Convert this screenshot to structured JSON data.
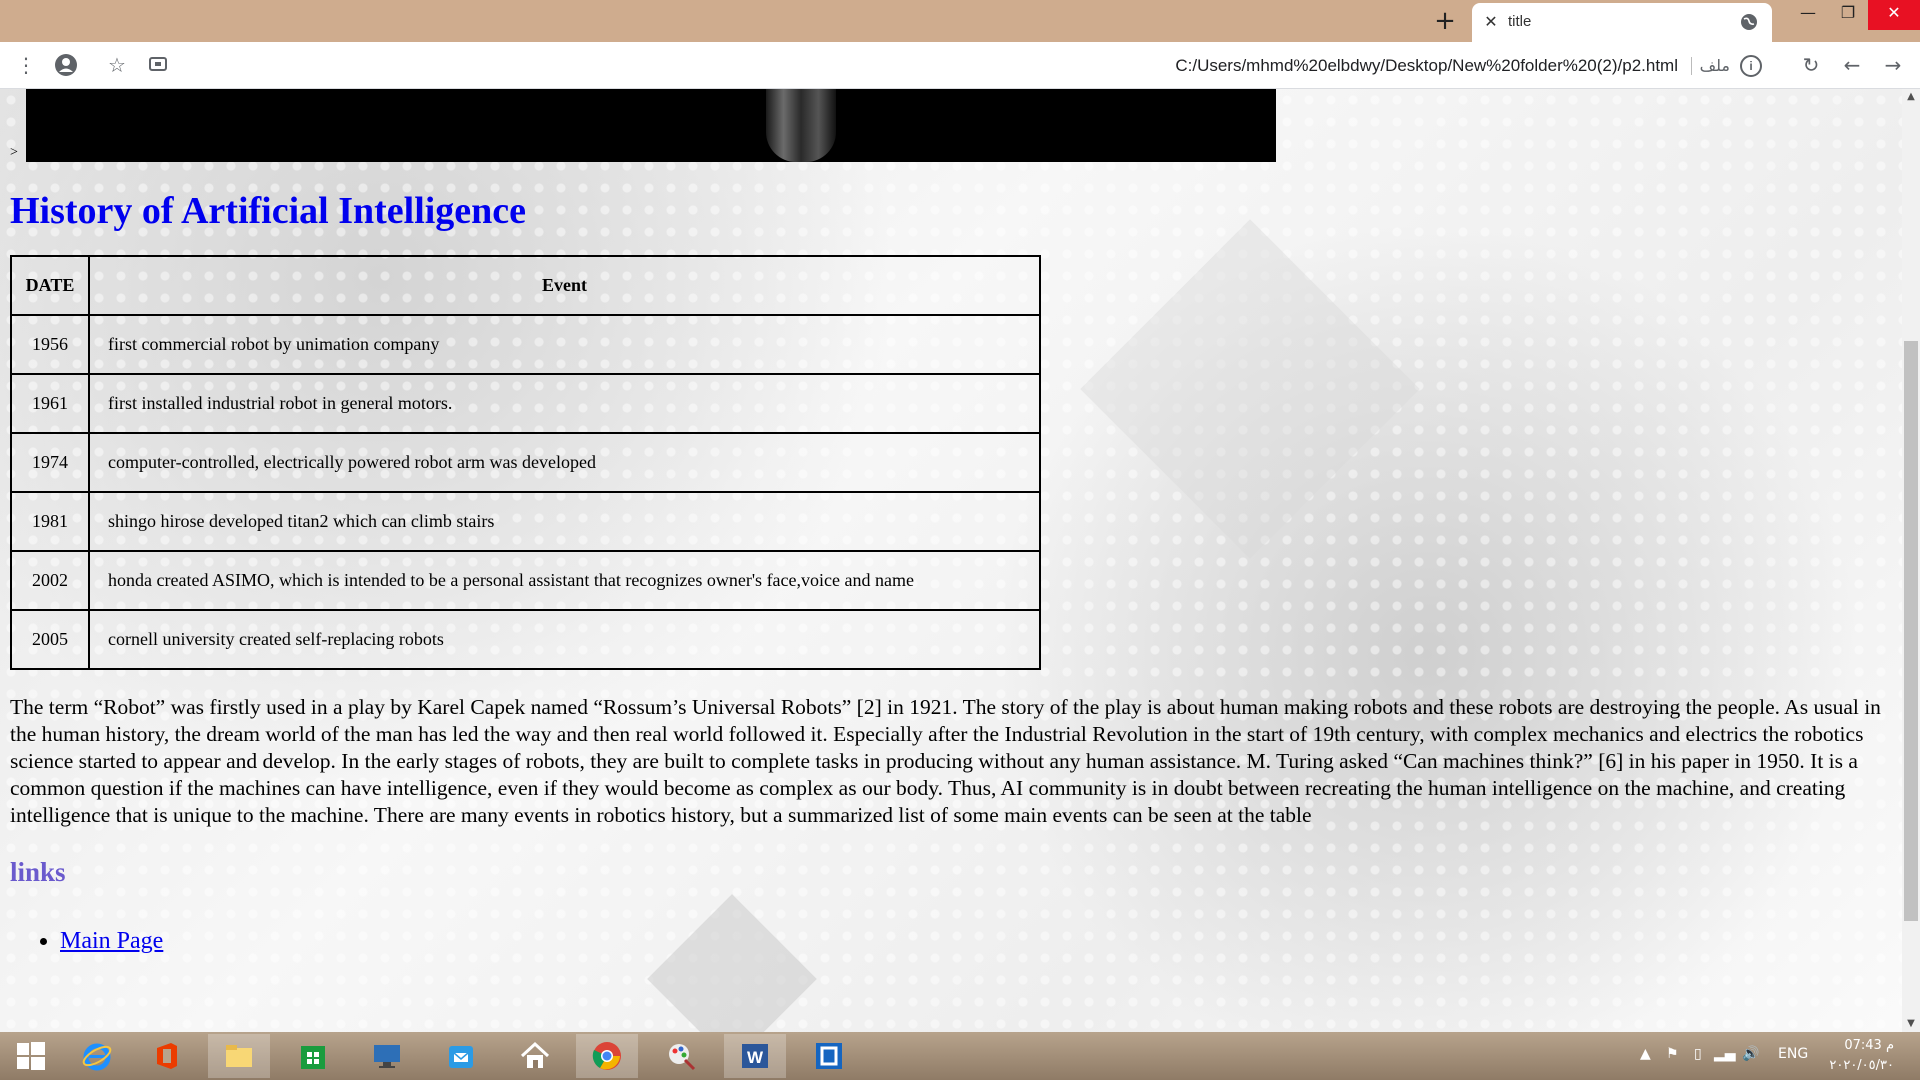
{
  "browser": {
    "tab": {
      "title": "title",
      "close_glyph": "✕"
    },
    "new_tab_glyph": "+",
    "window": {
      "minimize": "—",
      "maximize": "❐",
      "close": "✕"
    },
    "url": "C:/Users/mhmd%20elbdwy/Desktop/New%20folder%20(2)/p2.html",
    "omnibox_label": "ملف",
    "toolbar_icons": [
      "menu-icon",
      "profile-icon",
      "star-icon",
      "cast-icon",
      "reload-icon",
      "back-icon",
      "forward-icon"
    ]
  },
  "page": {
    "stray_text": ">",
    "heading": "History of Artificial Intelligence",
    "table": {
      "headers": [
        "DATE",
        "Event"
      ],
      "rows": [
        {
          "date": "1956",
          "event": "first commercial robot by unimation company"
        },
        {
          "date": "1961",
          "event": "first installed industrial robot in general motors."
        },
        {
          "date": "1974",
          "event": "computer-controlled, electrically powered robot arm was developed"
        },
        {
          "date": "1981",
          "event": "shingo hirose developed titan2 which can climb stairs"
        },
        {
          "date": "2002",
          "event": "honda created ASIMO, which is intended to be a personal assistant that recognizes owner's face,voice and name"
        },
        {
          "date": "2005",
          "event": "cornell university created self-replacing robots"
        }
      ]
    },
    "paragraph": "The term “Robot” was firstly used in a play by Karel Capek named “Rossum’s Universal Robots” [2] in 1921. The story of the play is about human making robots and these robots are destroying the people. As usual in the human history, the dream world of the man has led the way and then real world followed it. Especially after the Industrial Revolution in the start of 19th century, with complex mechanics and electrics the robotics science started to appear and develop. In the early stages of robots, they are built to complete tasks in producing without any human assistance. M. Turing asked “Can machines think?” [6] in his paper in 1950. It is a common question if the machines can have intelligence, even if they would become as complex as our body. Thus, AI community is in doubt between recreating the human intelligence on the machine, and creating intelligence that is unique to the machine. There are many events in robotics history, but a summarized list of some main events can be seen at the table",
    "links_heading": "links",
    "links": [
      "Main Page"
    ]
  },
  "colors": {
    "heading": "#0000ee",
    "links_heading": "#6a5acd",
    "titlebar": "#cfac8e",
    "close_button": "#e81123"
  },
  "taskbar": {
    "apps": [
      "windows-start-icon",
      "internet-explorer-icon",
      "office-icon",
      "file-explorer-icon",
      "store-icon",
      "lenovo-icon",
      "mail-icon",
      "home-icon",
      "chrome-icon",
      "paint-icon",
      "word-icon",
      "app-icon"
    ],
    "language": "ENG",
    "time": "07:43 م",
    "date": "٢٠٢٠/٠٥/٣٠"
  }
}
